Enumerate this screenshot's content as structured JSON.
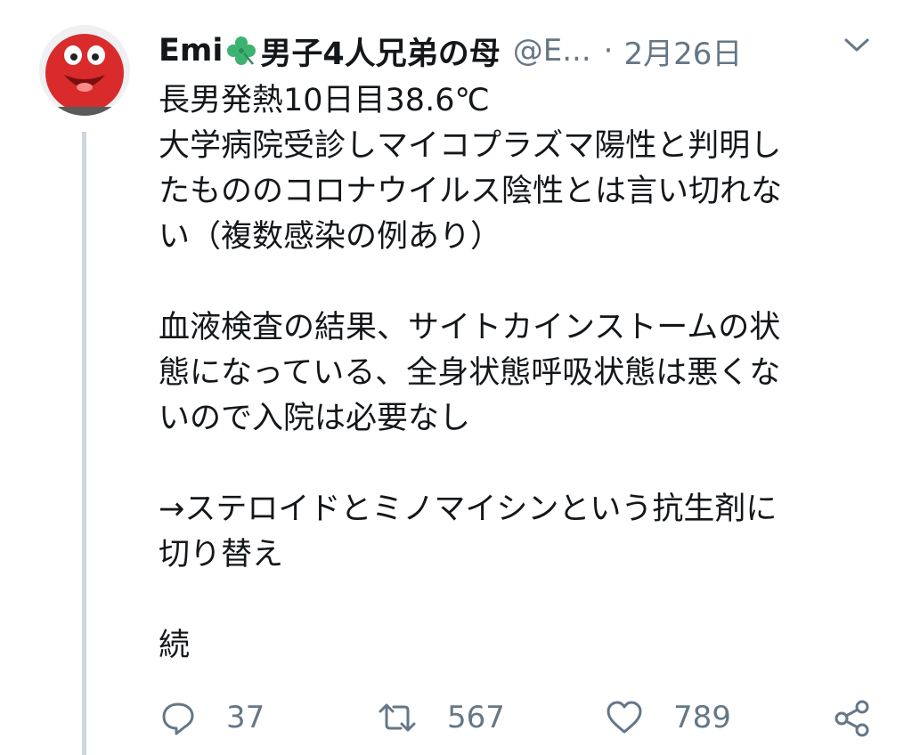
{
  "tweet": {
    "display_name_pre": "Emi",
    "display_name_post": "男子4人兄弟の母",
    "handle": "@E...",
    "separator": "·",
    "date": "2月26日",
    "lines": [
      "長男発熱10日目38.6℃",
      "大学病院受診しマイコプラズマ陽性と判明し",
      "たもののコロナウイルス陰性とは言い切れな",
      "い（複数感染の例あり）",
      "",
      "血液検査の結果、サイトカインストームの状",
      "態になっている、全身状態呼吸状態は悪くな",
      "いので入院は必要なし",
      "",
      "→ステロイドとミノマイシンという抗生剤に",
      "切り替え",
      "",
      "続"
    ],
    "actions": {
      "reply": {
        "icon": "reply-icon",
        "count": "37"
      },
      "retweet": {
        "icon": "retweet-icon",
        "count": "567"
      },
      "like": {
        "icon": "heart-icon",
        "count": "789"
      },
      "share": {
        "icon": "share-icon"
      }
    }
  },
  "colors": {
    "text": "#14171a",
    "secondary": "#657786",
    "thread_line": "#ccd6dd",
    "clover": "#3cb371",
    "avatar_red": "#d92b2b"
  }
}
